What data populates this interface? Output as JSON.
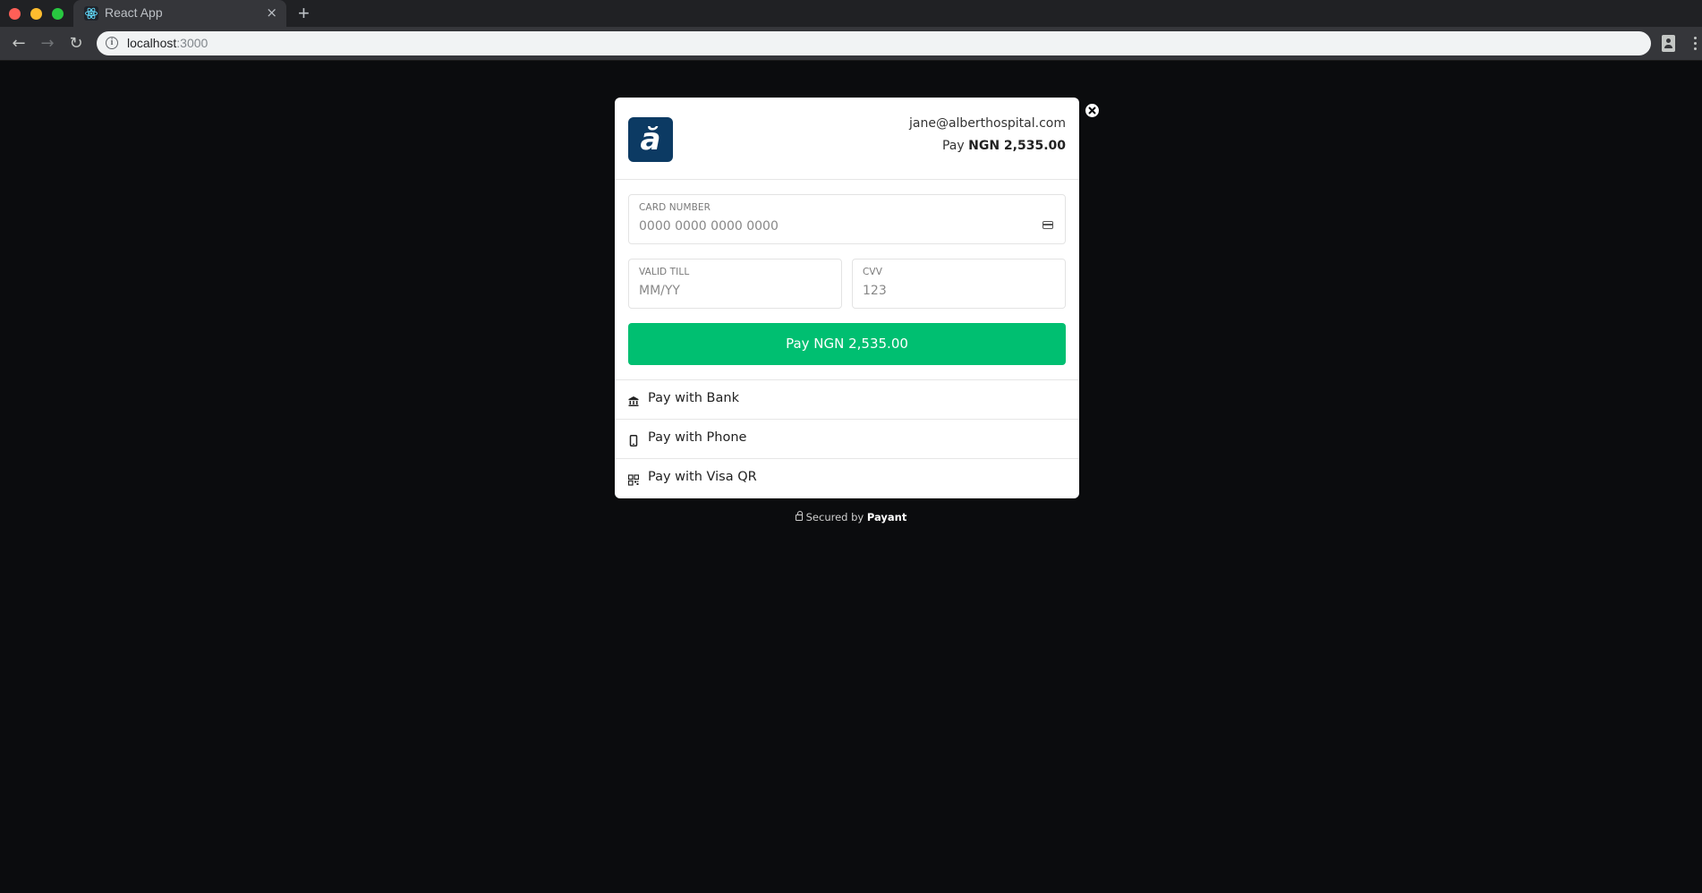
{
  "browser": {
    "tab_title": "React App",
    "tab_close": "×",
    "new_tab": "+",
    "url_host": "localhost",
    "url_port": ":3000",
    "icons": {
      "back": "←",
      "forward": "→",
      "reload": "↻",
      "info": "i"
    }
  },
  "modal": {
    "logo_letter": "ă",
    "email": "jane@alberthospital.com",
    "amount_prefix": "Pay ",
    "amount": "NGN 2,535.00",
    "card_number": {
      "label": "CARD NUMBER",
      "placeholder": "0000 0000 0000 0000",
      "value": ""
    },
    "valid_till": {
      "label": "VALID TILL",
      "placeholder": "MM/YY",
      "value": ""
    },
    "cvv": {
      "label": "CVV",
      "placeholder": "123",
      "value": ""
    },
    "pay_button": "Pay NGN 2,535.00",
    "alt_methods": [
      {
        "label": "Pay with Bank",
        "icon": "bank-icon"
      },
      {
        "label": "Pay with Phone",
        "icon": "phone-icon"
      },
      {
        "label": "Pay with Visa QR",
        "icon": "qr-code-icon"
      }
    ]
  },
  "footer": {
    "secured_prefix": "Secured by ",
    "brand": "Payant"
  },
  "colors": {
    "accent": "#00bf71",
    "logo_bg": "#0c3a63",
    "page_bg": "#0b0c0e"
  }
}
